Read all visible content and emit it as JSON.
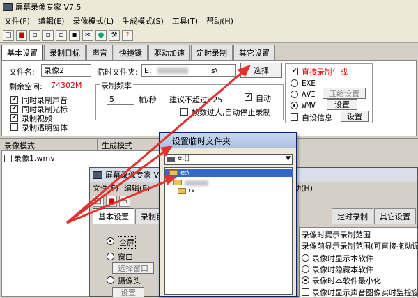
{
  "title": "屏幕录像专家 V7.5",
  "menu": [
    "文件(F)",
    "编辑(E)",
    "录像模式(L)",
    "生成模式(S)",
    "工具(T)",
    "帮助(H)"
  ],
  "tabs": [
    "基本设置",
    "录制目标",
    "声音",
    "快捷键",
    "驱动加速",
    "定时录制",
    "其它设置"
  ],
  "basic": {
    "filename_label": "文件名:",
    "filename_value": "录像2",
    "tempdir_label": "临时文件夹:",
    "tempdir_value_left": "E:",
    "tempdir_value_right": "ls\\",
    "choose_button": "选择",
    "space_label": "剩余空间:",
    "space_value": "74302M",
    "chk_audio": "同时录制声音",
    "chk_cursor": "同时录制光标",
    "chk_video": "录制视频",
    "chk_transparent": "录制透明窗体",
    "freq_group": "录制频率",
    "freq_value": "5",
    "freq_unit": "帧/秒",
    "suggest": "建议不超过: 25",
    "auto_label": "自动",
    "stop_label": "帧数过大,自动停止录制"
  },
  "output": {
    "direct_label": "直接录制生成",
    "exe_label": "EXE",
    "avi_label": "AVI",
    "wmv_label": "WMV",
    "compress_button": "压缩设置",
    "settings_button": "设置",
    "custom_info_label": "自设信息",
    "settings_button2": "设置"
  },
  "sections": {
    "record_mode": "录像模式",
    "generate_mode": "生成模式"
  },
  "files": [
    "录像1.wmv"
  ],
  "dialog": {
    "title": "设置临时文件夹",
    "combo_value": "e:[]",
    "items": [
      "e:\\",
      "rs"
    ]
  },
  "win2": {
    "title": "屏幕录像专家 V",
    "menu": [
      "文件(F)",
      "编辑(E)"
    ],
    "menu_right": "动(H)",
    "tabs": [
      "基本设置",
      "录制目"
    ],
    "tabs_right": [
      "定时录制",
      "其它设置"
    ],
    "opt_fullscreen": "全屏",
    "opt_window": "窗口",
    "choose_window_button": "选择窗口",
    "opt_camera": "摄像头",
    "settings_button": "设置",
    "right_items": [
      "录像时提示录制范围",
      "录像前显示录制范围(可直接拖动调",
      "录像时显示本软件",
      "录像时隐藏本软件",
      "录像时本软件最小化",
      "录像时显示声音图像实时监控窗体"
    ]
  },
  "colors": {
    "arrow": "#e53030",
    "selection": "#316ac5",
    "warn_text": "#d40000"
  }
}
